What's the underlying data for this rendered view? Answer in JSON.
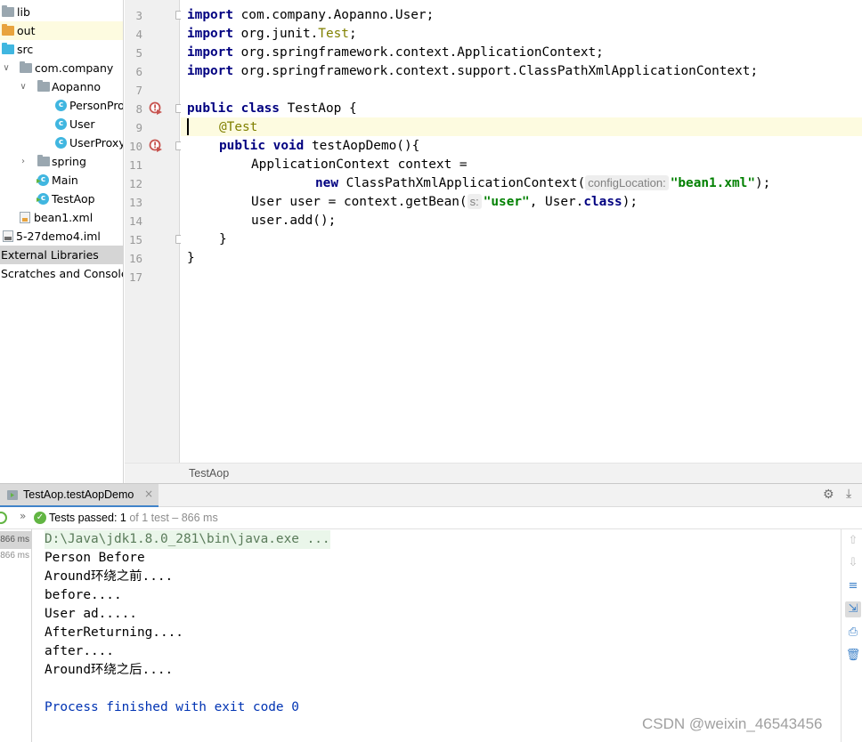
{
  "project_tree": {
    "items": [
      {
        "label": "lib",
        "icon": "folder-icon"
      },
      {
        "label": "out",
        "icon": "folder-excluded-icon"
      },
      {
        "label": "src",
        "icon": "source-folder-icon"
      },
      {
        "label": "com.company",
        "icon": "package-icon"
      },
      {
        "label": "Aopanno",
        "icon": "package-icon"
      },
      {
        "label": "PersonProxy",
        "icon": "class-icon"
      },
      {
        "label": "User",
        "icon": "class-icon"
      },
      {
        "label": "UserProxy",
        "icon": "class-icon"
      },
      {
        "label": "spring",
        "icon": "package-icon"
      },
      {
        "label": "Main",
        "icon": "runnable-class-icon"
      },
      {
        "label": "TestAop",
        "icon": "runnable-class-icon"
      },
      {
        "label": "bean1.xml",
        "icon": "xml-file-icon"
      },
      {
        "label": "5-27demo4.iml",
        "icon": "iml-file-icon"
      },
      {
        "label": "External Libraries",
        "icon": "library-icon"
      },
      {
        "label": "Scratches and Consoles",
        "icon": "scratch-icon"
      }
    ],
    "item_class_glyph": "c"
  },
  "editor": {
    "line_numbers": [
      "3",
      "4",
      "5",
      "6",
      "7",
      "8",
      "9",
      "10",
      "11",
      "12",
      "13",
      "14",
      "15",
      "16",
      "17"
    ],
    "lines": {
      "l3": {
        "kw": "import",
        "rest": " com.company.Aopanno.User;"
      },
      "l4": {
        "kw": "import",
        "rest": " org.junit.",
        "ann": "Test",
        "end": ";"
      },
      "l5": {
        "kw": "import",
        "rest": " org.springframework.context.ApplicationContext;"
      },
      "l6": {
        "kw": "import",
        "rest": " org.springframework.context.support.ClassPathXmlApplicationContext;"
      },
      "l8": {
        "kw1": "public",
        "kw2": "class",
        "rest": " TestAop {"
      },
      "l9": {
        "ann": "@Test"
      },
      "l10": {
        "kw1": "public",
        "kw2": "void",
        "rest": " testAopDemo(){"
      },
      "l11": {
        "text": "ApplicationContext context ="
      },
      "l12": {
        "kw": "new",
        "call": " ClassPathXmlApplicationContext(",
        "hint": "configLocation:",
        "str": "\"bean1.xml\"",
        "end": ");"
      },
      "l13": {
        "start": "User user = context.getBean(",
        "hint": "s:",
        "str": "\"user\"",
        "mid": ", User.",
        "kw": "class",
        "end": ");"
      },
      "l14": {
        "text": "user.add();"
      },
      "l15": {
        "text": "}"
      },
      "l16": {
        "text": "}"
      }
    },
    "breadcrumb": "TestAop"
  },
  "run_window": {
    "tab_label": "TestAop.testAopDemo",
    "status": {
      "prefix": "Tests passed: ",
      "count": "1",
      "suffix": " of 1 test – 866 ms"
    },
    "test_tree_times": [
      "866 ms",
      "866 ms"
    ],
    "console_lines": [
      "D:\\Java\\jdk1.8.0_281\\bin\\java.exe ...",
      "Person Before",
      "Around环绕之前....",
      "before....",
      "User ad.....",
      "AfterReturning....",
      "after....",
      "Around环绕之后....",
      "",
      "Process finished with exit code 0"
    ]
  },
  "watermark": "CSDN @weixin_46543456",
  "colors": {
    "keyword": "#000080",
    "annotation": "#808000",
    "string": "#008000",
    "current_line": "#fdfbe0",
    "pass_green": "#62b543"
  }
}
